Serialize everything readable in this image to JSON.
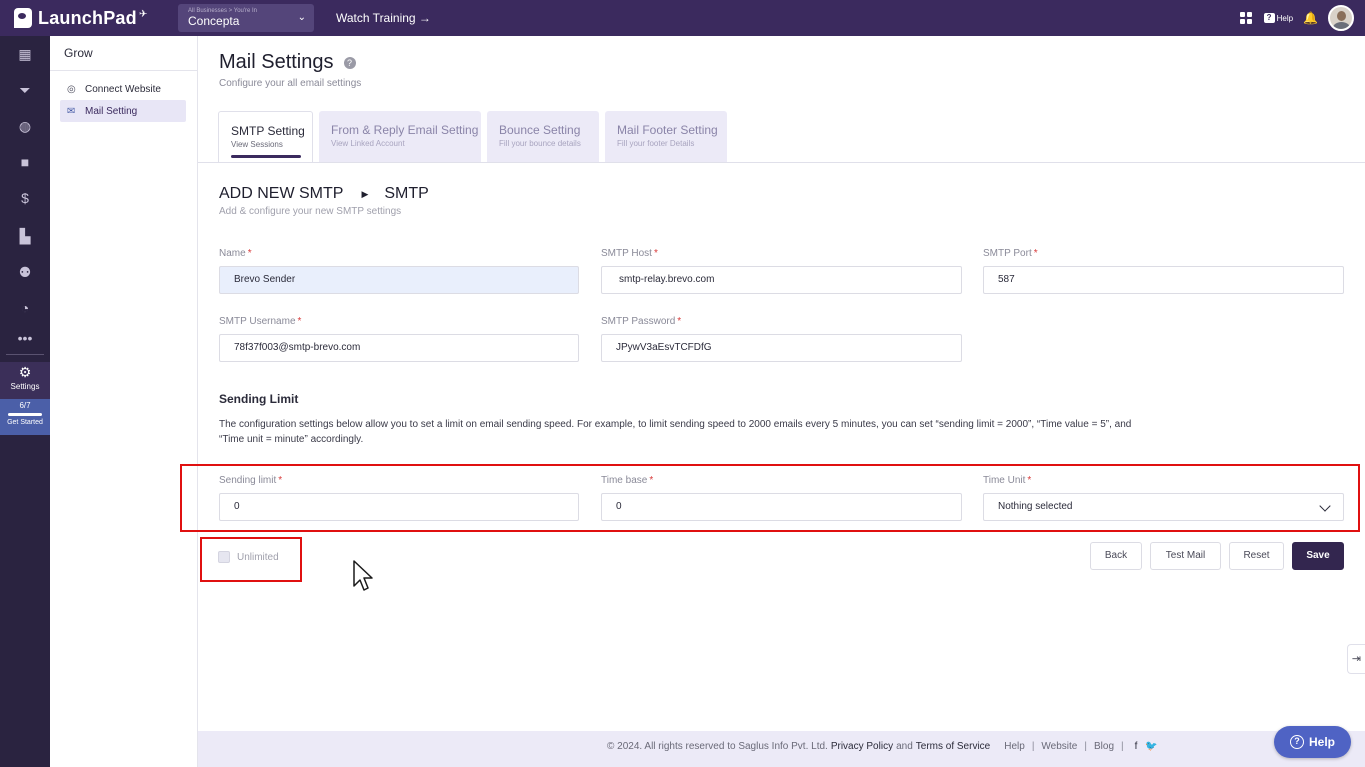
{
  "topbar": {
    "logo_text": "LaunchPad",
    "business_crumb": "All Businesses > You're In",
    "business_name": "Concepta",
    "watch_training": "Watch Training →",
    "help_label": "Help"
  },
  "rail": {
    "settings_label": "Settings",
    "progress": "6/7",
    "get_started": "Get Started"
  },
  "sidebar": {
    "title": "Grow",
    "items": [
      {
        "label": "Connect Website"
      },
      {
        "label": "Mail Setting"
      }
    ]
  },
  "page": {
    "title": "Mail Settings",
    "subtitle": "Configure your all email settings"
  },
  "tabs": [
    {
      "label": "SMTP Setting",
      "sub": "View Sessions"
    },
    {
      "label": "From & Reply Email Setting",
      "sub": "View Linked Account"
    },
    {
      "label": "Bounce Setting",
      "sub": "Fill your bounce details"
    },
    {
      "label": "Mail Footer Setting",
      "sub": "Fill your footer Details"
    }
  ],
  "section": {
    "crumb": "ADD NEW SMTP",
    "current": "SMTP",
    "subtitle": "Add & configure your new SMTP settings"
  },
  "form": {
    "name_label": "Name",
    "name_value": "Brevo Sender",
    "host_label": "SMTP Host",
    "host_value": "smtp-relay.brevo.com",
    "port_label": "SMTP Port",
    "port_value": "587",
    "username_label": "SMTP Username",
    "username_value": "78f37f003@smtp-brevo.com",
    "password_label": "SMTP Password",
    "password_value": "JPywV3aEsvTCFDfG",
    "req": "*"
  },
  "limit": {
    "title": "Sending Limit",
    "description": "The configuration settings below allow you to set a limit on email sending speed. For example, to limit sending speed to 2000 emails every 5 minutes, you can set “sending limit = 2000”, “Time value = 5”, and “Time unit = minute” accordingly.",
    "sending_limit_label": "Sending limit",
    "sending_limit_value": "0",
    "time_base_label": "Time base",
    "time_base_value": "0",
    "time_unit_label": "Time Unit",
    "time_unit_value": "Nothing selected",
    "unlimited_label": "Unlimited"
  },
  "buttons": {
    "back": "Back",
    "test_mail": "Test Mail",
    "reset": "Reset",
    "save": "Save"
  },
  "footer": {
    "copyright": "©  2024. All rights reserved to Saglus Info Pvt. Ltd.",
    "privacy": "Privacy Policy",
    "and": "and",
    "terms": "Terms of Service",
    "help": "Help",
    "website": "Website",
    "blog": "Blog",
    "sep": "|"
  },
  "help_fab": "Help",
  "colors": {
    "topbar": "#3b2a5e",
    "rail": "#2a2340",
    "primary_button": "#33264f",
    "highlight": "#e01010",
    "help_fab": "#4f63c4"
  }
}
